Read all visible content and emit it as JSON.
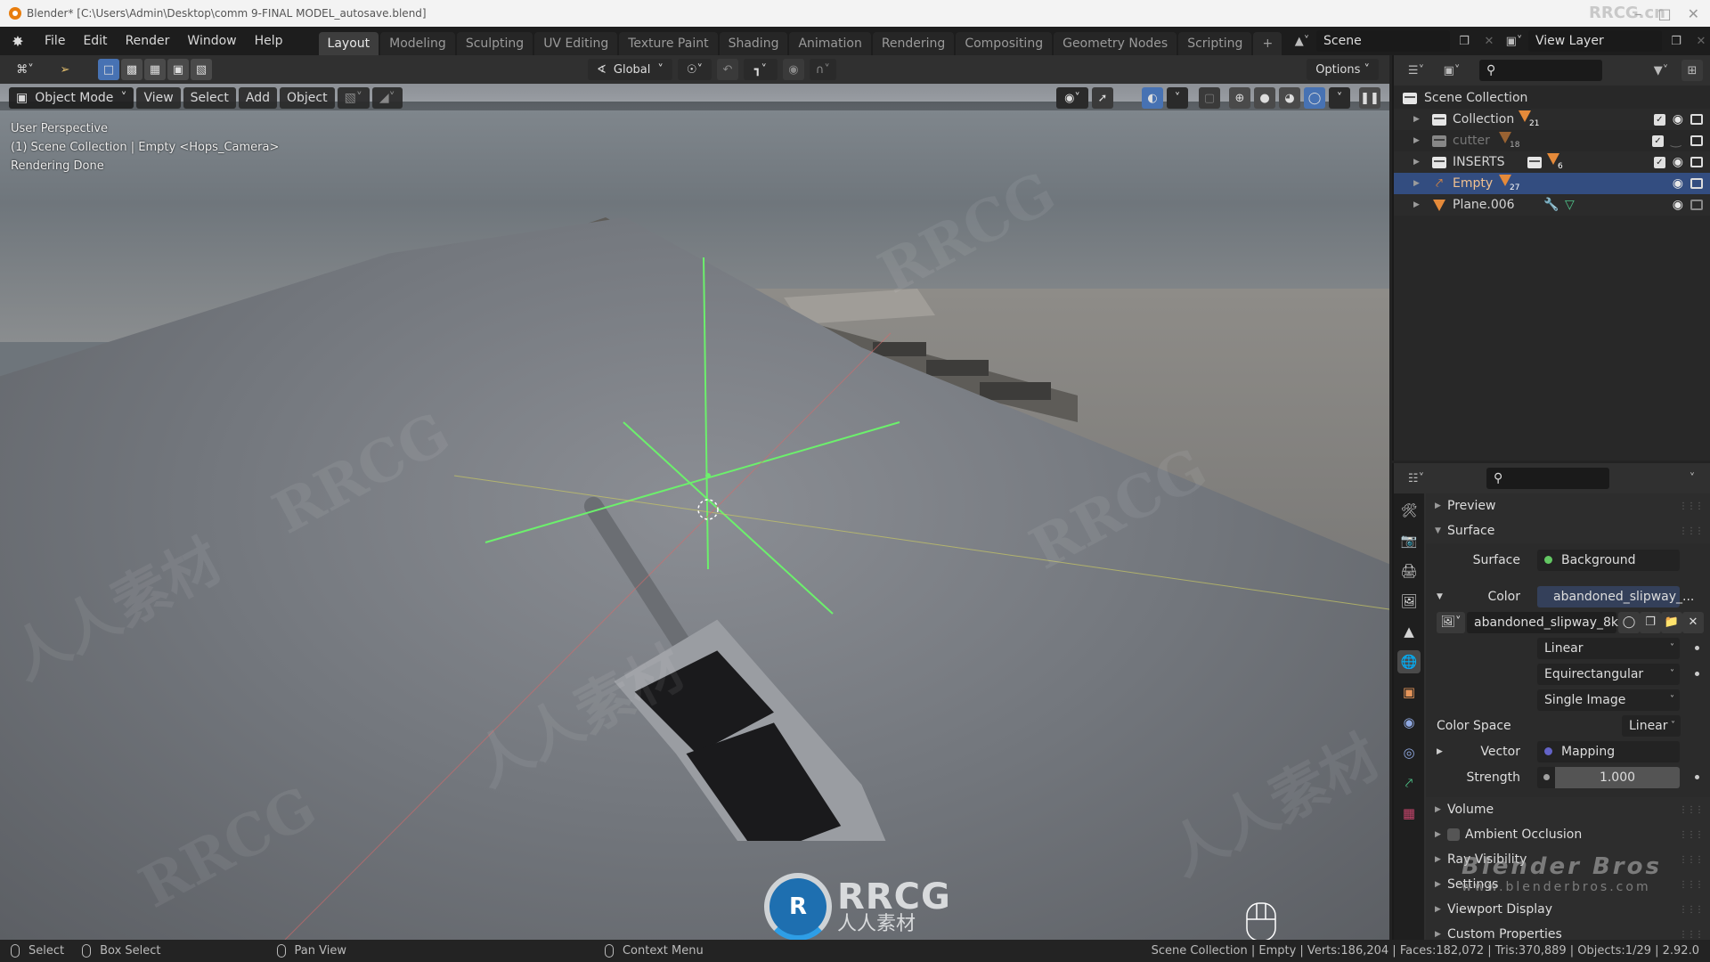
{
  "window": {
    "title": "Blender* [C:\\Users\\Admin\\Desktop\\comm 9-FINAL MODEL_autosave.blend]",
    "watermark_corner": "RRCG.cn"
  },
  "menu": {
    "items": [
      "File",
      "Edit",
      "Render",
      "Window",
      "Help"
    ]
  },
  "workspaces": {
    "tabs": [
      "Layout",
      "Modeling",
      "Sculpting",
      "UV Editing",
      "Texture Paint",
      "Shading",
      "Animation",
      "Rendering",
      "Compositing",
      "Geometry Nodes",
      "Scripting"
    ],
    "active": "Layout",
    "add_label": "+"
  },
  "scene": {
    "scene_name": "Scene",
    "view_layer": "View Layer"
  },
  "tool_header": {
    "transform_orientation": "Global",
    "options_label": "Options"
  },
  "viewport": {
    "mode": "Object Mode",
    "menus": [
      "View",
      "Select",
      "Add",
      "Object"
    ],
    "overlay_text": [
      "User Perspective",
      "(1) Scene Collection | Empty <Hops_Camera>",
      "Rendering Done"
    ],
    "shading_active": "rendered",
    "watermarks": [
      "RRCG",
      "人人素材"
    ],
    "logo": {
      "main": "RRCG",
      "sub": "人人素材",
      "mark": "R"
    }
  },
  "outliner": {
    "root": "Scene Collection",
    "rows": [
      {
        "name": "Collection",
        "type": "collection",
        "badge": "21",
        "checked": true,
        "visible": true,
        "render": true,
        "selected": false,
        "dimmed": false
      },
      {
        "name": "cutter",
        "type": "collection",
        "badge": "18",
        "checked": true,
        "visible": false,
        "render": true,
        "selected": false,
        "dimmed": true
      },
      {
        "name": "INSERTS",
        "type": "collection",
        "badge": "6",
        "checked": true,
        "visible": true,
        "render": true,
        "selected": false,
        "dimmed": false,
        "extra_collection_icon": true
      },
      {
        "name": "Empty",
        "type": "empty",
        "badge": "27",
        "checked": null,
        "visible": true,
        "render": true,
        "selected": true,
        "dimmed": false
      },
      {
        "name": "Plane.006",
        "type": "mesh",
        "badge": "",
        "checked": null,
        "visible": true,
        "render": false,
        "selected": false,
        "dimmed": false,
        "modifiers": true
      }
    ]
  },
  "properties": {
    "panels_top": [
      {
        "label": "Preview",
        "expanded": false
      },
      {
        "label": "Surface",
        "expanded": true
      }
    ],
    "surface": {
      "surface_label": "Surface",
      "surface_value": "Background",
      "color_label": "Color",
      "color_value": "abandoned_slipway_...",
      "image_name": "abandoned_slipway_8k....",
      "interpolation": "Linear",
      "projection": "Equirectangular",
      "source": "Single Image",
      "color_space_label": "Color Space",
      "color_space": "Linear",
      "vector_label": "Vector",
      "vector_value": "Mapping",
      "strength_label": "Strength",
      "strength_value": "1.000"
    },
    "panels_bottom": [
      {
        "label": "Volume",
        "checkbox": false
      },
      {
        "label": "Ambient Occlusion",
        "checkbox": true
      },
      {
        "label": "Ray Visibility",
        "checkbox": false
      },
      {
        "label": "Settings",
        "checkbox": false
      },
      {
        "label": "Viewport Display",
        "checkbox": false
      },
      {
        "label": "Custom Properties",
        "checkbox": false
      }
    ],
    "overlay_brand": {
      "title": "Blender Bros",
      "url": "www.blenderbros.com"
    },
    "colors": {
      "surface_socket": "#63c763",
      "color_socket": "#c7c729",
      "vector_socket": "#6363c7",
      "world_tab": "#e04a6a"
    }
  },
  "statusbar": {
    "left": [
      {
        "label": "Select"
      },
      {
        "label": "Box Select"
      },
      {
        "label": "Pan View"
      },
      {
        "label": "Context Menu"
      }
    ],
    "right": "Scene Collection | Empty | Verts:186,204 | Faces:182,072 | Tris:370,889 | Objects:1/29 | 2.92.0"
  }
}
